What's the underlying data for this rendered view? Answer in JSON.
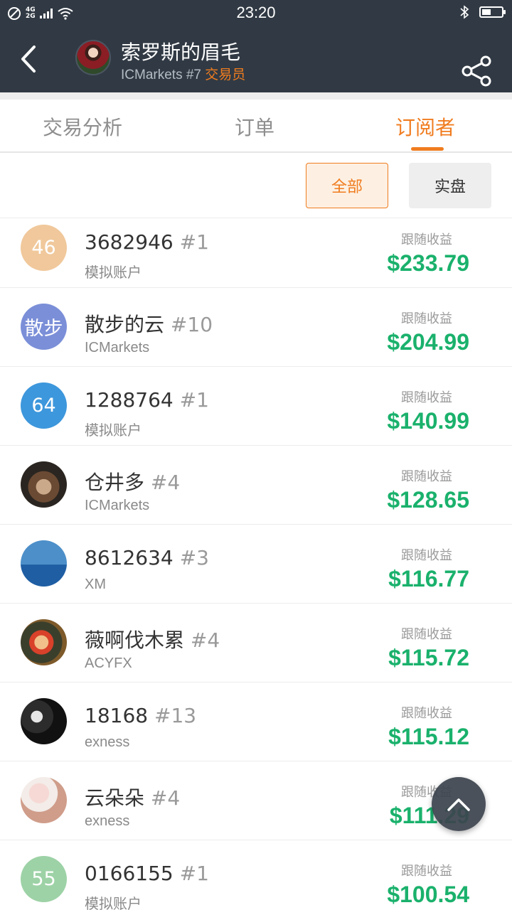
{
  "status_bar": {
    "network": "4G 2G",
    "time": "23:20"
  },
  "header": {
    "trader_name": "索罗斯的眉毛",
    "broker_rank": "ICMarkets #7",
    "role": "交易员"
  },
  "tabs": [
    {
      "label": "交易分析",
      "active": false
    },
    {
      "label": "订单",
      "active": false
    },
    {
      "label": "订阅者",
      "active": true
    }
  ],
  "filters": {
    "all_label": "全部",
    "real_label": "实盘",
    "selected": "全部"
  },
  "colors": {
    "accent": "#f07c1f",
    "profit": "#1ab16c",
    "header_bg": "#313a44"
  },
  "subscribers": [
    {
      "avatar_text": "46",
      "avatar_color": "#f0c89b",
      "name": "3682946",
      "rank": "#1",
      "broker": "模拟账户",
      "profit_label": "跟随收益",
      "profit": "$233.79"
    },
    {
      "avatar_text": "散步",
      "avatar_color": "#7b8fd8",
      "name": "散步的云",
      "rank": "#10",
      "broker": "ICMarkets",
      "profit_label": "跟随收益",
      "profit": "$204.99"
    },
    {
      "avatar_text": "64",
      "avatar_color": "#3d97dc",
      "name": "1288764",
      "rank": "#1",
      "broker": "模拟账户",
      "profit_label": "跟随收益",
      "profit": "$140.99"
    },
    {
      "avatar_text": "",
      "avatar_image": "dog-photo",
      "name": "仓井多",
      "rank": "#4",
      "broker": "ICMarkets",
      "profit_label": "跟随收益",
      "profit": "$128.65"
    },
    {
      "avatar_text": "",
      "avatar_image": "sea-ship-photo",
      "name": "8612634",
      "rank": "#3",
      "broker": "XM",
      "profit_label": "跟随收益",
      "profit": "$116.77"
    },
    {
      "avatar_text": "",
      "avatar_image": "cartoon-face-photo",
      "name": "薇啊伐木累",
      "rank": "#4",
      "broker": "ACYFX",
      "profit_label": "跟随收益",
      "profit": "$115.72"
    },
    {
      "avatar_text": "",
      "avatar_image": "buy-sell-dice-photo",
      "name": "18168",
      "rank": "#13",
      "broker": "exness",
      "profit_label": "跟随收益",
      "profit": "$115.12"
    },
    {
      "avatar_text": "",
      "avatar_image": "girl-with-dog-photo",
      "name": "云朵朵",
      "rank": "#4",
      "broker": "exness",
      "profit_label": "跟随收益",
      "profit": "$111.29"
    },
    {
      "avatar_text": "55",
      "avatar_color": "#9dd2a6",
      "name": "0166155",
      "rank": "#1",
      "broker": "模拟账户",
      "profit_label": "跟随收益",
      "profit": "$100.54"
    }
  ]
}
